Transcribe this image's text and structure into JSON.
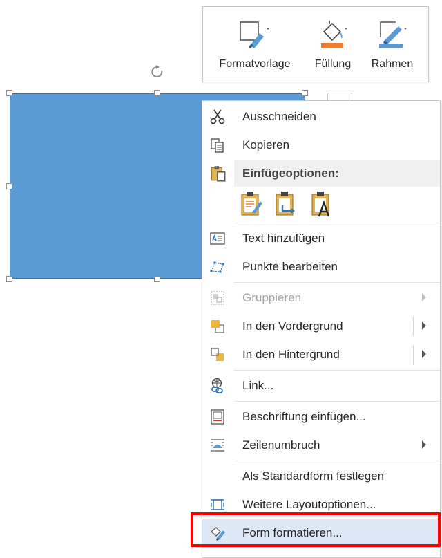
{
  "mini_toolbar": {
    "style_label": "Formatvorlage",
    "fill_label": "Füllung",
    "border_label": "Rahmen"
  },
  "context_menu": {
    "items": [
      {
        "label": "Ausschneiden",
        "icon": "scissors-icon"
      },
      {
        "label": "Kopieren",
        "icon": "copy-icon"
      },
      {
        "label": "Einfügeoptionen:",
        "icon": "paste-icon"
      },
      {
        "label": "Text hinzufügen",
        "icon": "text-box-icon"
      },
      {
        "label": "Punkte bearbeiten",
        "icon": "edit-points-icon"
      },
      {
        "label": "Gruppieren",
        "icon": "group-icon",
        "disabled": true,
        "submenu": true
      },
      {
        "label": "In den Vordergrund",
        "icon": "bring-forward-icon",
        "submenu": true
      },
      {
        "label": "In den Hintergrund",
        "icon": "send-backward-icon",
        "submenu": true
      },
      {
        "label": "Link...",
        "icon": "link-icon"
      },
      {
        "label": "Beschriftung einfügen...",
        "icon": "insert-caption-icon"
      },
      {
        "label": "Zeilenumbruch",
        "icon": "wrap-text-icon",
        "submenu": true
      },
      {
        "label": "Als Standardform festlegen",
        "icon": ""
      },
      {
        "label": "Weitere Layoutoptionen...",
        "icon": "layout-options-icon"
      },
      {
        "label": "Form formatieren...",
        "icon": "format-shape-icon",
        "highlighted": true
      }
    ],
    "paste_options": [
      "paste-keep-formatting-icon",
      "paste-picture-icon",
      "paste-text-only-icon"
    ]
  },
  "colors": {
    "shape_fill": "#5b9bd5",
    "fill_accent": "#ed7d31",
    "border_accent": "#5b9bd5",
    "highlight_bg": "#dde8f6",
    "annotation_red": "#ff0000"
  }
}
